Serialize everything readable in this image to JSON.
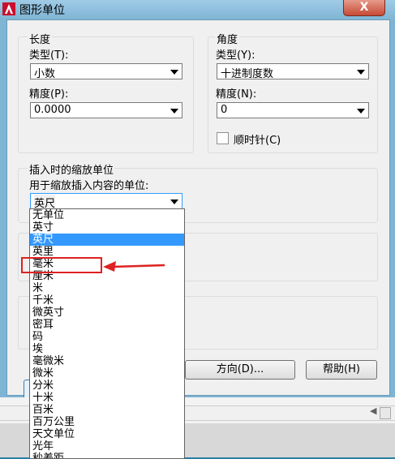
{
  "window": {
    "title": "图形单位",
    "close_label": "X"
  },
  "length": {
    "group_label": "长度",
    "type_label": "类型(T):",
    "type_value": "小数",
    "precision_label": "精度(P):",
    "precision_value": "0.0000"
  },
  "angle": {
    "group_label": "角度",
    "type_label": "类型(Y):",
    "type_value": "十进制度数",
    "precision_label": "精度(N):",
    "precision_value": "0",
    "clockwise_label": "顺时针(C)"
  },
  "insertion": {
    "group_label": "插入时的缩放单位",
    "sub_label": "用于缩放插入内容的单位:",
    "value": "英尺",
    "options": [
      "无单位",
      "英寸",
      "英尺",
      "英里",
      "毫米",
      "厘米",
      "米",
      "千米",
      "微英寸",
      "密耳",
      "码",
      "埃",
      "毫微米",
      "微米",
      "分米",
      "十米",
      "百米",
      "百万公里",
      "天文单位",
      "光年",
      "秒差距"
    ],
    "selected_index": 2,
    "highlighted_index": 4
  },
  "buttons": {
    "direction": "方向(D)...",
    "help": "帮助(H)"
  },
  "colors": {
    "title_bar": "#7fb5d4",
    "close_button": "#c74a36",
    "selection": "#3399ff",
    "callout": "#dd2222"
  }
}
